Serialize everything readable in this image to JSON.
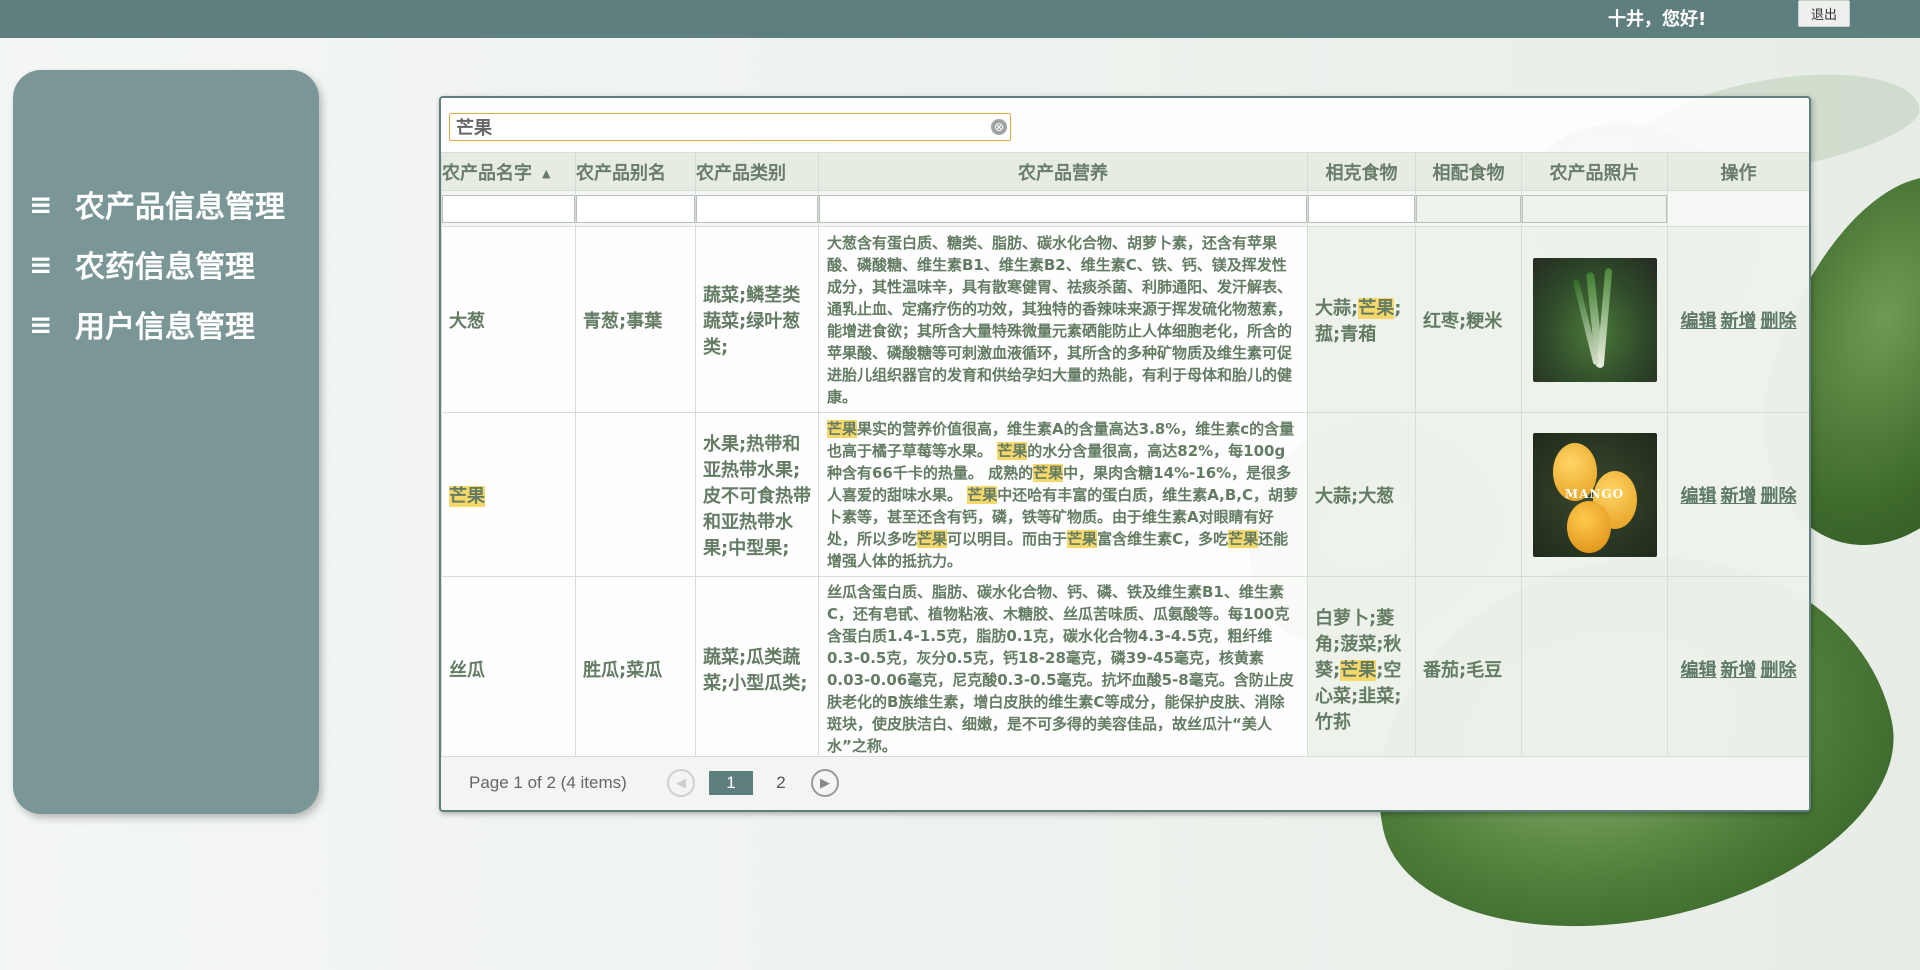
{
  "header": {
    "greeting": "十井，您好!",
    "logout_label": "退出"
  },
  "sidebar": {
    "items": [
      {
        "icon": "≡",
        "label": "农产品信息管理"
      },
      {
        "icon": "≡",
        "label": "农药信息管理"
      },
      {
        "icon": "≡",
        "label": "用户信息管理"
      }
    ]
  },
  "search": {
    "value": "芒果",
    "clear_icon": "⊗"
  },
  "table": {
    "columns": [
      "农产品名字",
      "农产品别名",
      "农产品类别",
      "农产品营养",
      "相克食物",
      "相配食物",
      "农产品照片",
      "操作"
    ],
    "sort_icon": "▲",
    "rows": [
      {
        "name": "大葱",
        "alias": "青葱;事葉",
        "category": "蔬菜;鳞茎类蔬菜;绿叶葱类;",
        "nutrition": "大葱含有蛋白质、糖类、脂肪、碳水化合物、胡萝卜素，还含有苹果酸、磷酸糖、维生素B1、维生素B2、维生素C、铁、钙、镁及挥发性成分，其性温味辛，具有散寒健胃、祛痰杀菌、利肺通阳、发汗解表、通乳止血、定痛疗伤的功效，其独特的香辣味来源于挥发硫化物葱素，能增进食欲；其所含大量特殊微量元素硒能防止人体细胞老化，所含的苹果酸、磷酸糖等可刺激血液循环，其所含的多种矿物质及维生素可促进胎儿组织器官的发育和供给孕妇大量的热能，有利于母体和胎儿的健康。",
        "incompatible_pre": "大蒜;",
        "incompatible_hl": "芒果",
        "incompatible_post": ";菰;青葙",
        "compatible": "红枣;粳米",
        "photo": "green-onion-photo",
        "ops": {
          "edit": "编辑",
          "add": "新增",
          "delete": "删除"
        }
      },
      {
        "name": "芒果",
        "alias": "",
        "category": "水果;热带和亚热带水果;皮不可食热带和亚热带水果;中型果;",
        "nutrition_parts": [
          {
            "t": "芒果",
            "hl": true
          },
          {
            "t": "果实的营养价值很高，维生素A的含量高达3.8%，维生素c的含量也高于橘子草莓等水果。 ",
            "hl": false
          },
          {
            "t": "芒果",
            "hl": true
          },
          {
            "t": "的水分含量很高，高达82%，每100g种含有66千卡的热量。 成熟的",
            "hl": false
          },
          {
            "t": "芒果",
            "hl": true
          },
          {
            "t": "中，果肉含糖14%-16%，是很多人喜爱的甜味水果。 ",
            "hl": false
          },
          {
            "t": "芒果",
            "hl": true
          },
          {
            "t": "中还哈有丰富的蛋白质，维生素A,B,C，胡萝卜素等，甚至还含有钙，磷，铁等矿物质。由于维生素A对眼睛有好处，所以多吃",
            "hl": false
          },
          {
            "t": "芒果",
            "hl": true
          },
          {
            "t": "可以明目。而由于",
            "hl": false
          },
          {
            "t": "芒果",
            "hl": true
          },
          {
            "t": "富含维生素C，多吃",
            "hl": false
          },
          {
            "t": "芒果",
            "hl": true
          },
          {
            "t": "还能增强人体的抵抗力。",
            "hl": false
          }
        ],
        "incompatible": "大蒜;大葱",
        "compatible": "",
        "photo": "mango-photo",
        "photo_caption": "MANGO",
        "ops": {
          "edit": "编辑",
          "add": "新增",
          "delete": "删除"
        }
      },
      {
        "name": "丝瓜",
        "alias": "胜瓜;菜瓜",
        "category": "蔬菜;瓜类蔬菜;小型瓜类;",
        "nutrition": "丝瓜含蛋白质、脂肪、碳水化合物、钙、磷、铁及维生素B1、维生素C，还有皂甙、植物粘液、木糖胶、丝瓜苦味质、瓜氨酸等。每100克含蛋白质1.4-1.5克，脂肪0.1克，碳水化合物4.3-4.5克，粗纤维0.3-0.5克，灰分0.5克，钙18-28毫克，磷39-45毫克，核黄素0.03-0.06毫克，尼克酸0.3-0.5毫克。抗坏血酸5-8毫克。含防止皮肤老化的B族维生素，增白皮肤的维生素C等成分，能保护皮肤、消除斑块，使皮肤洁白、细嫩，是不可多得的美容佳品，故丝瓜汁“美人水”之称。",
        "incompatible_pre": "白萝卜;菱角;菠菜;秋葵;",
        "incompatible_hl": "芒果",
        "incompatible_post": ";空心菜;韭菜;竹荪",
        "compatible": "番茄;毛豆",
        "photo": "",
        "ops": {
          "edit": "编辑",
          "add": "新增",
          "delete": "删除"
        }
      }
    ]
  },
  "pager": {
    "info": "Page 1 of 2 (4 items)",
    "pages": [
      "1",
      "2"
    ],
    "current": "1",
    "prev_icon": "◀",
    "next_icon": "▶"
  },
  "colors": {
    "topbar": "#5f7e7e",
    "sidebar": "#7b9696",
    "highlight": "#f6d76a",
    "text": "#637c63"
  }
}
